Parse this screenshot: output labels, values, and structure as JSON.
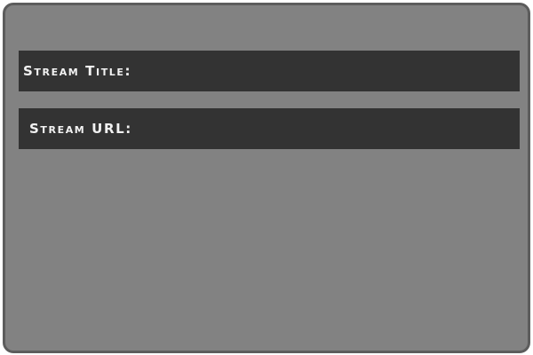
{
  "fields": {
    "stream_title_label": "Stream Title:",
    "stream_url_label": "Stream URL:"
  }
}
